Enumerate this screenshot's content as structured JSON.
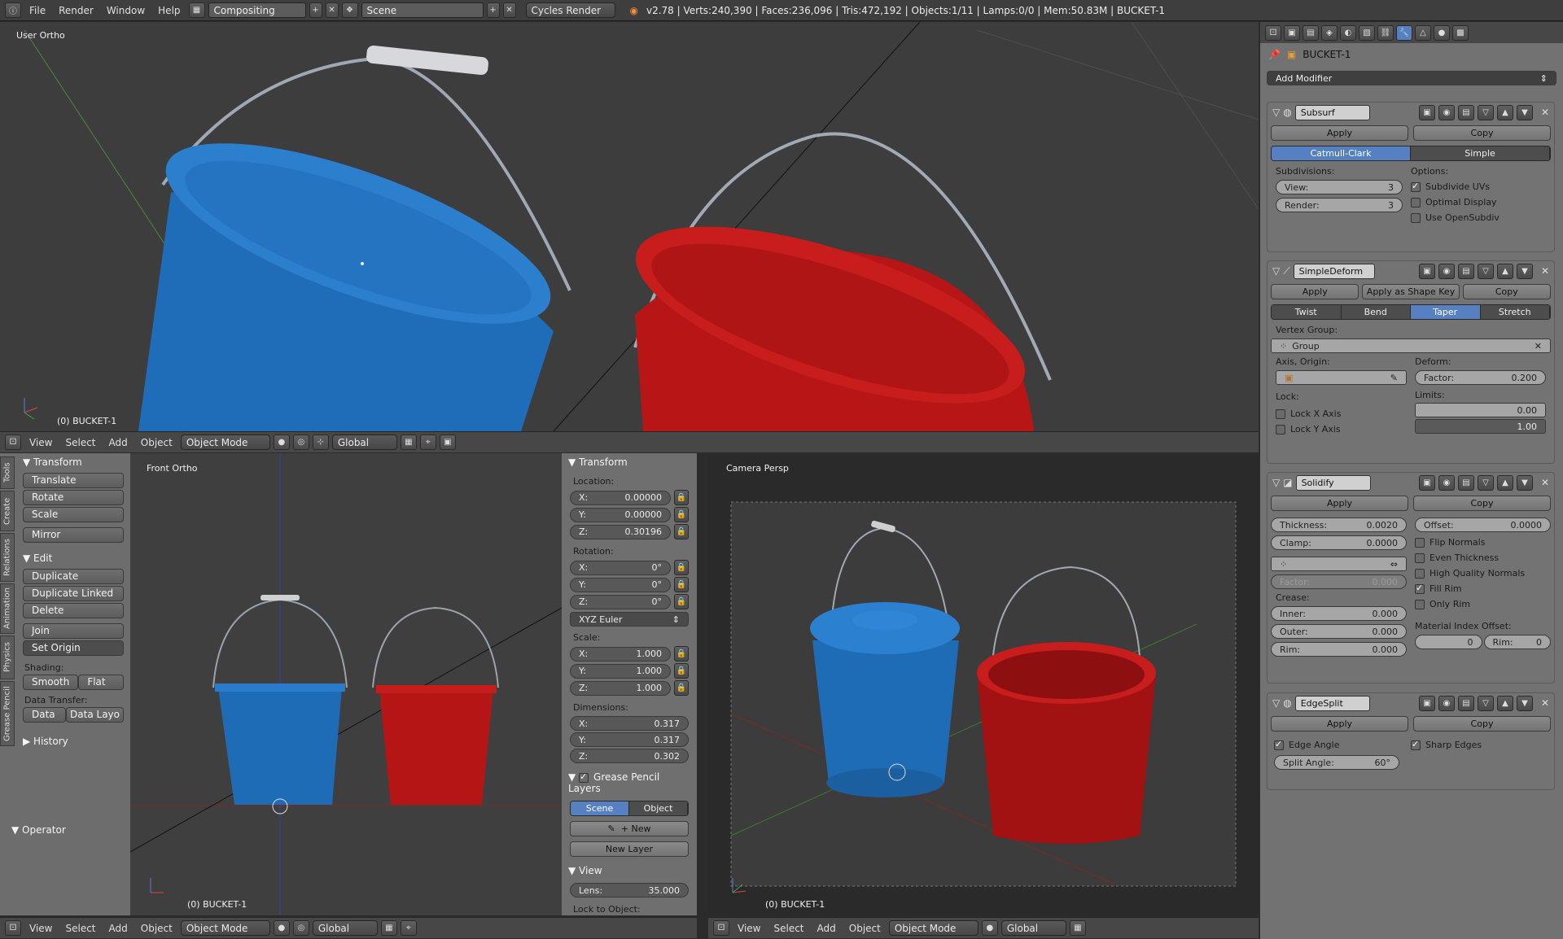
{
  "topbar": {
    "menus": [
      "File",
      "Render",
      "Window",
      "Help"
    ],
    "screen_layout": "Compositing",
    "scene": "Scene",
    "engine": "Cycles Render",
    "stats": "v2.78 | Verts:240,390 | Faces:236,096 | Tris:472,192 | Objects:1/11 | Lamps:0/0 | Mem:50.83M | BUCKET-1"
  },
  "viewport_top": {
    "view_label": "User Ortho",
    "object_label": "(0) BUCKET-1"
  },
  "viewport_header": {
    "menus": [
      "View",
      "Select",
      "Add",
      "Object"
    ],
    "mode": "Object Mode",
    "orientation": "Global"
  },
  "toolshelf": {
    "tabs": [
      "Tools",
      "Create",
      "Relations",
      "Animation",
      "Physics",
      "Grease Pencil"
    ],
    "transform_title": "Transform",
    "transform_buttons": [
      "Translate",
      "Rotate",
      "Scale"
    ],
    "mirror": "Mirror",
    "edit_title": "Edit",
    "edit_buttons": [
      "Duplicate",
      "Duplicate Linked",
      "Delete"
    ],
    "join": "Join",
    "set_origin": "Set Origin",
    "shading_label": "Shading:",
    "smooth": "Smooth",
    "flat": "Flat",
    "data_transfer_label": "Data Transfer:",
    "data": "Data",
    "data_layo": "Data Layo",
    "history": "History",
    "operator": "Operator"
  },
  "viewport_front": {
    "view_label": "Front Ortho",
    "object_label": "(0) BUCKET-1"
  },
  "npanel": {
    "transform_title": "Transform",
    "location_label": "Location:",
    "location": [
      {
        "axis": "X:",
        "value": "0.00000"
      },
      {
        "axis": "Y:",
        "value": "0.00000"
      },
      {
        "axis": "Z:",
        "value": "0.30196"
      }
    ],
    "rotation_label": "Rotation:",
    "rotation": [
      {
        "axis": "X:",
        "value": "0°"
      },
      {
        "axis": "Y:",
        "value": "0°"
      },
      {
        "axis": "Z:",
        "value": "0°"
      }
    ],
    "rotation_mode": "XYZ Euler",
    "scale_label": "Scale:",
    "scale": [
      {
        "axis": "X:",
        "value": "1.000"
      },
      {
        "axis": "Y:",
        "value": "1.000"
      },
      {
        "axis": "Z:",
        "value": "1.000"
      }
    ],
    "dimensions_label": "Dimensions:",
    "dimensions": [
      {
        "axis": "X:",
        "value": "0.317"
      },
      {
        "axis": "Y:",
        "value": "0.317"
      },
      {
        "axis": "Z:",
        "value": "0.302"
      }
    ],
    "grease_title": "Grease Pencil Layers",
    "scene_btn": "Scene",
    "object_btn": "Object",
    "new_btn": "New",
    "new_layer": "New Layer",
    "view_title": "View",
    "lens_label": "Lens:",
    "lens_value": "35.000",
    "lock_label": "Lock to Object:"
  },
  "viewport_camera": {
    "view_label": "Camera Persp",
    "object_label": "(0) BUCKET-1"
  },
  "properties": {
    "object_name": "BUCKET-1",
    "add_modifier": "Add Modifier",
    "subsurf": {
      "name": "Subsurf",
      "apply": "Apply",
      "copy": "Copy",
      "catmull": "Catmull-Clark",
      "simple": "Simple",
      "subdiv_label": "Subdivisions:",
      "view_label": "View:",
      "view_val": "3",
      "render_label": "Render:",
      "render_val": "3",
      "options_label": "Options:",
      "opt1": "Subdivide UVs",
      "opt2": "Optimal Display",
      "opt3": "Use OpenSubdiv"
    },
    "simpledeform": {
      "name": "SimpleDeform",
      "apply": "Apply",
      "apply_shape": "Apply as Shape Key",
      "copy": "Copy",
      "modes": [
        "Twist",
        "Bend",
        "Taper",
        "Stretch"
      ],
      "vgroup_label": "Vertex Group:",
      "group": "Group",
      "axis_label": "Axis, Origin:",
      "deform_label": "Deform:",
      "factor_label": "Factor:",
      "factor_val": "0.200",
      "lock_label": "Lock:",
      "lockx": "Lock X Axis",
      "locky": "Lock Y Axis",
      "limits_label": "Limits:",
      "lim1": "0.00",
      "lim2": "1.00"
    },
    "solidify": {
      "name": "Solidify",
      "apply": "Apply",
      "copy": "Copy",
      "thick_label": "Thickness:",
      "thick_val": "0.0020",
      "offset_label": "Offset:",
      "offset_val": "0.0000",
      "clamp_label": "Clamp:",
      "clamp_val": "0.0000",
      "flip": "Flip Normals",
      "even": "Even Thickness",
      "hq": "High Quality Normals",
      "factor_label": "Factor:",
      "factor_val": "0.000",
      "fill": "Fill Rim",
      "only": "Only Rim",
      "crease_label": "Crease:",
      "inner_label": "Inner:",
      "inner_val": "0.000",
      "outer_label": "Outer:",
      "outer_val": "0.000",
      "rim_label": "Rim:",
      "rim_val": "0.000",
      "mat_label": "Material Index Offset:",
      "mat_val": "0",
      "mat_rim_label": "Rim:",
      "mat_rim_val": "0"
    },
    "edgesplit": {
      "name": "EdgeSplit",
      "apply": "Apply",
      "copy": "Copy",
      "edge_angle": "Edge Angle",
      "sharp": "Sharp Edges",
      "split_label": "Split Angle:",
      "split_val": "60°"
    }
  }
}
